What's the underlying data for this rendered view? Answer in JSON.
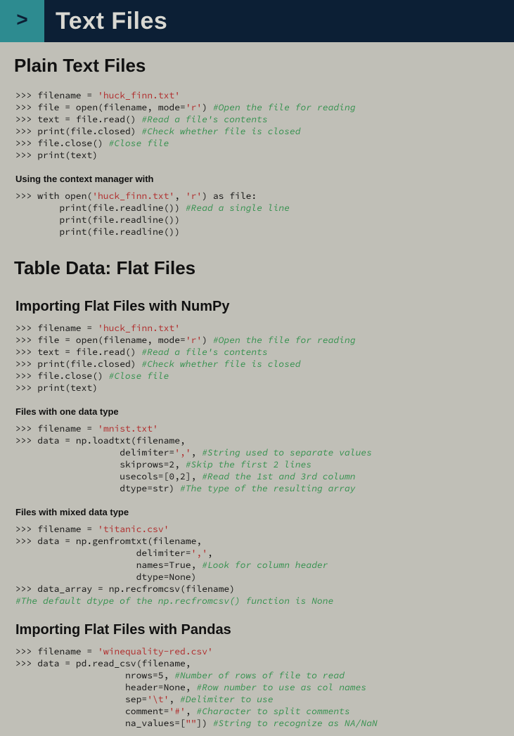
{
  "header": {
    "prompt": ">",
    "title": "Text Files"
  },
  "sections": {
    "plain_text": {
      "title": "Plain Text Files",
      "code1": {
        "l1a": ">>> filename = ",
        "l1s": "'huck_finn.txt'",
        "l2a": ">>> file = open(filename, mode=",
        "l2s": "'r'",
        "l2b": ") ",
        "l2c": "#Open the file for reading",
        "l3a": ">>> text = file.read() ",
        "l3c": "#Read a file's contents",
        "l4a": ">>> print(file.closed) ",
        "l4c": "#Check whether file is closed",
        "l5a": ">>> file.close() ",
        "l5c": "#Close file",
        "l6a": ">>> print(text)"
      },
      "note1": "Using the context manager with",
      "code2": {
        "l1a": ">>> with open(",
        "l1s1": "'huck_finn.txt'",
        "l1b": ", ",
        "l1s2": "'r'",
        "l1c": ") as file:",
        "l2a": "        print(file.readline()) ",
        "l2c": "#Read a single line",
        "l3a": "        print(file.readline())",
        "l4a": "        print(file.readline())"
      }
    },
    "table_data": {
      "title": "Table Data: Flat Files",
      "numpy_title": "Importing Flat Files with NumPy",
      "code_np1": {
        "l1a": ">>> filename = ",
        "l1s": "'huck_finn.txt'",
        "l2a": ">>> file = open(filename, mode=",
        "l2s": "'r'",
        "l2b": ") ",
        "l2c": "#Open the file for reading",
        "l3a": ">>> text = file.read() ",
        "l3c": "#Read a file's contents",
        "l4a": ">>> print(file.closed) ",
        "l4c": "#Check whether file is closed",
        "l5a": ">>> file.close() ",
        "l5c": "#Close file",
        "l6a": ">>> print(text)"
      },
      "note_one": "Files with one data type",
      "code_np2": {
        "l1a": ">>> filename = ",
        "l1s": "'mnist.txt'",
        "l2a": ">>> data = np.loadtxt(filename,",
        "l3a": "                   delimiter=",
        "l3s": "','",
        "l3b": ", ",
        "l3c": "#String used to separate values",
        "l4a": "                   skiprows=2, ",
        "l4c": "#Skip the first 2 lines",
        "l5a": "                   usecols=[0,2], ",
        "l5c": "#Read the 1st and 3rd column",
        "l6a": "                   dtype=str) ",
        "l6c": "#The type of the resulting array"
      },
      "note_mixed": "Files with mixed data type",
      "code_np3": {
        "l1a": ">>> filename = ",
        "l1s": "'titanic.csv'",
        "l2a": ">>> data = np.genfromtxt(filename,",
        "l3a": "                      delimiter=",
        "l3s": "','",
        "l3b": ",",
        "l4a": "                      names=True, ",
        "l4c": "#Look for column header",
        "l5a": "                      dtype=None)",
        "l6a": ">>> data_array = np.recfromcsv(filename)",
        "l7c": "#The default dtype of the np.recfromcsv() function is None"
      },
      "pandas_title": "Importing Flat Files with Pandas",
      "code_pd": {
        "l1a": ">>> filename = ",
        "l1s": "'winequality-red.csv'",
        "l2a": ">>> data = pd.read_csv(filename,",
        "l3a": "                    nrows=5, ",
        "l3c": "#Number of rows of file to read",
        "l4a": "                    header=None, ",
        "l4c": "#Row number to use as col names",
        "l5a": "                    sep=",
        "l5s": "'\\t'",
        "l5b": ", ",
        "l5c": "#Delimiter to use",
        "l6a": "                    comment=",
        "l6s": "'#'",
        "l6b": ", ",
        "l6c": "#Character to split comments",
        "l7a": "                    na_values=[",
        "l7s": "\"\"",
        "l7b": "]) ",
        "l7c": "#String to recognize as NA/NaN"
      }
    }
  }
}
